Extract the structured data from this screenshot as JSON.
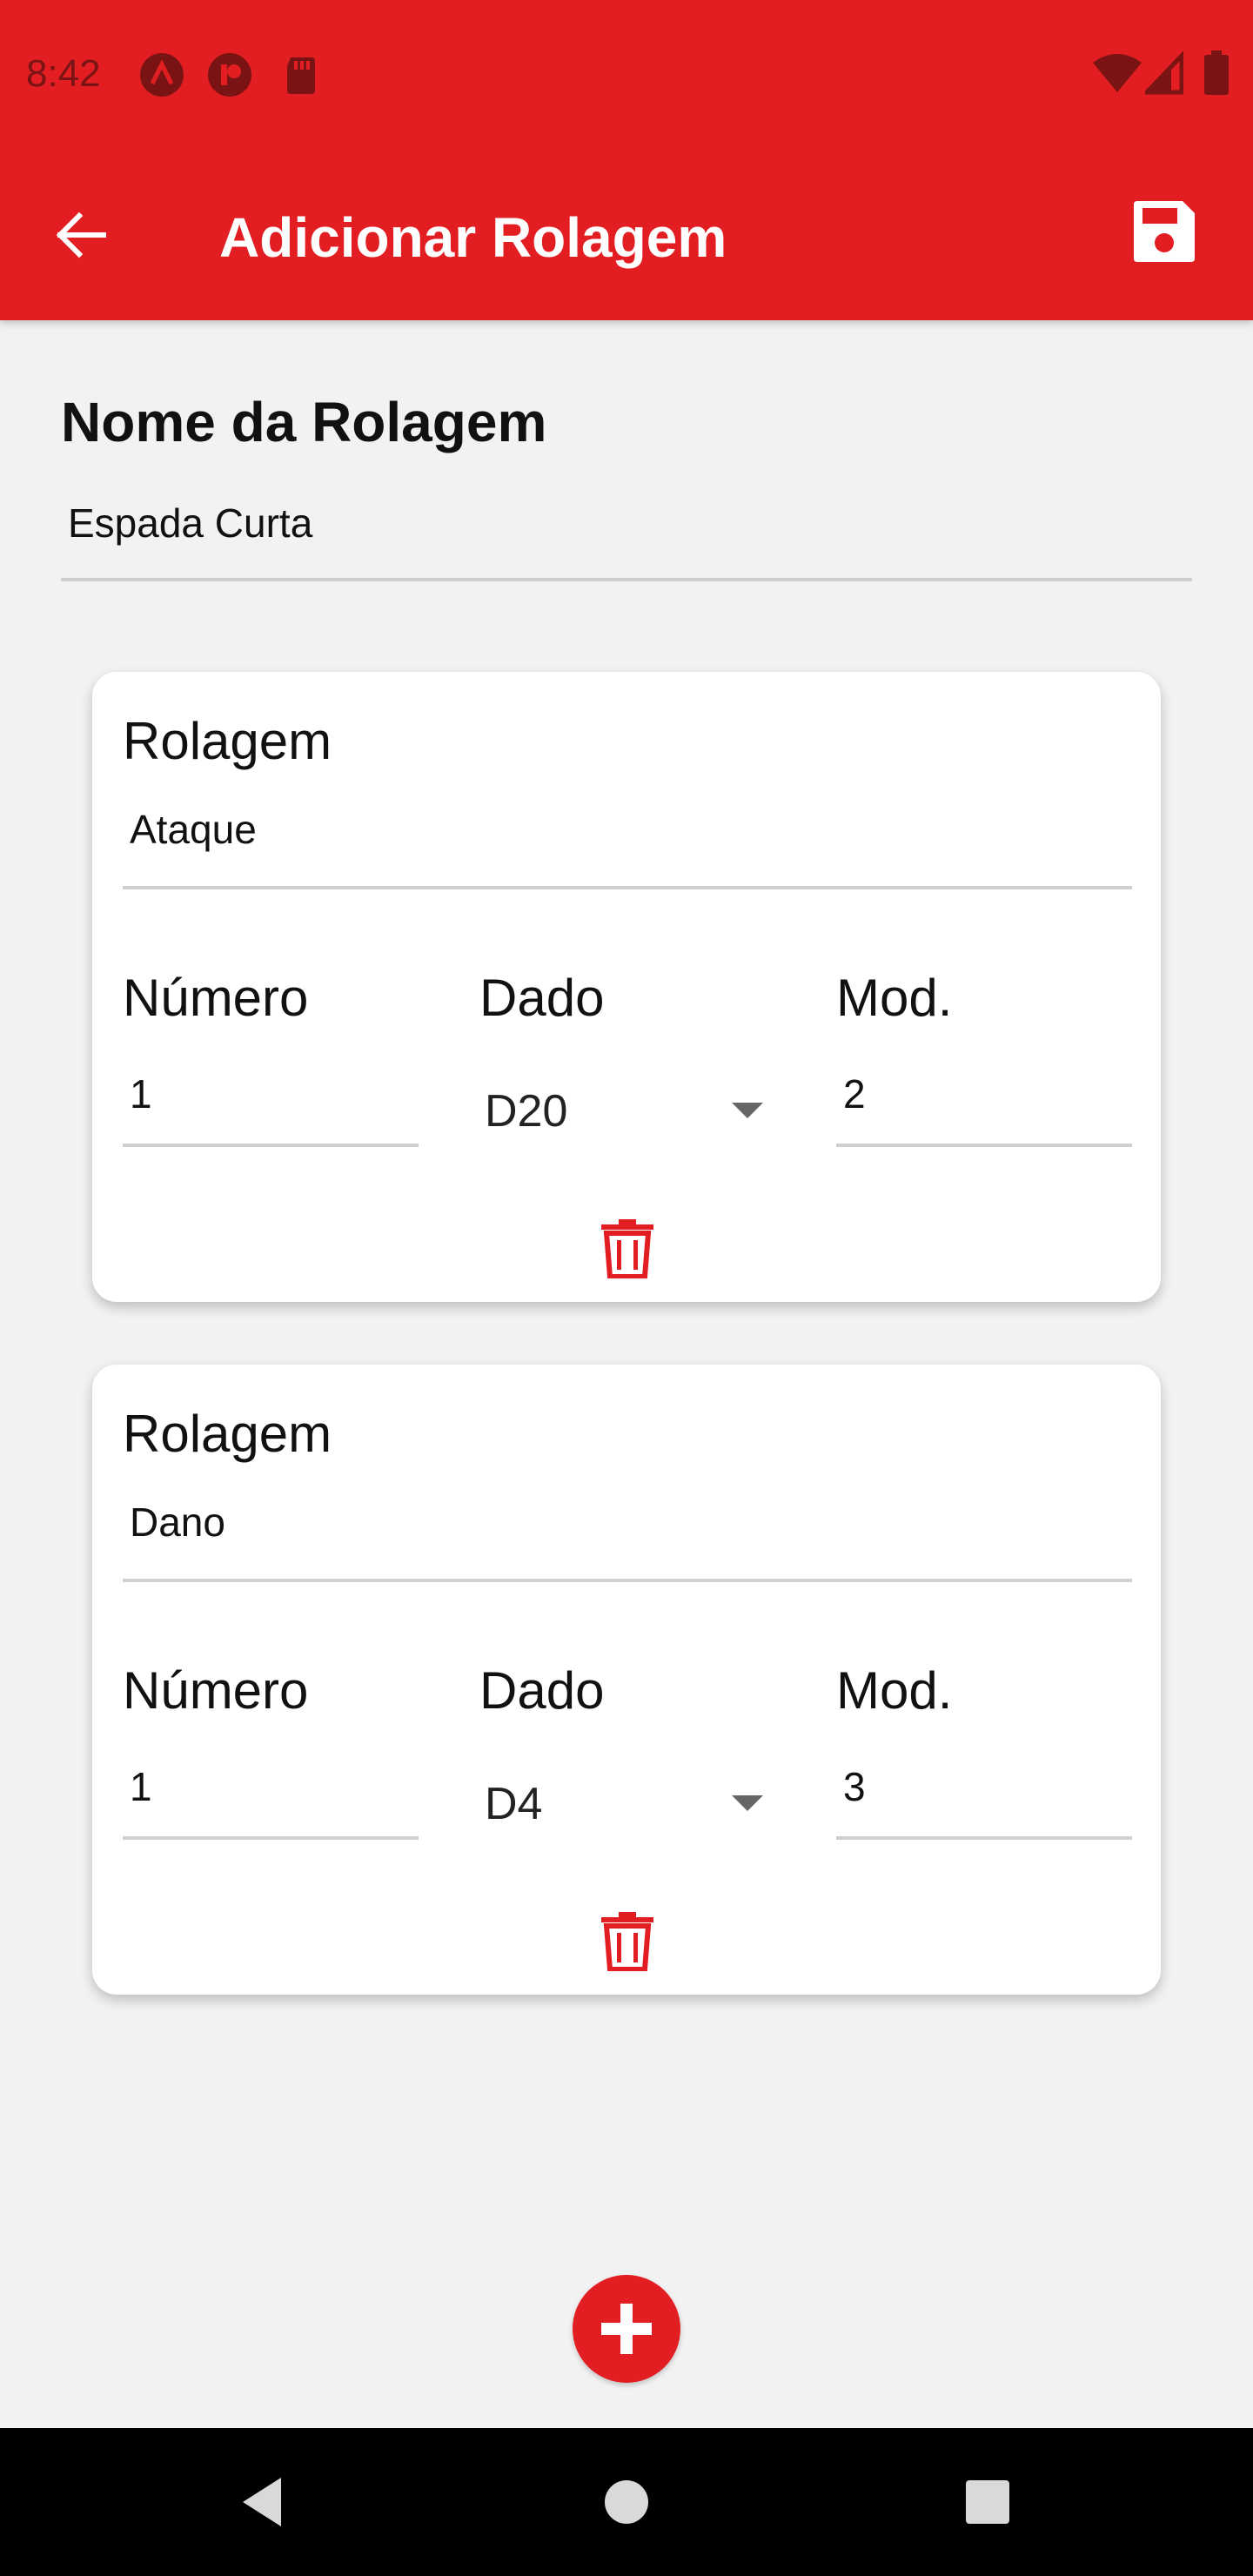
{
  "status_bar": {
    "time": "8:42",
    "left_icons": [
      "app-a-icon",
      "app-p-icon",
      "sd-card-icon"
    ],
    "right_icons": [
      "wifi-icon",
      "signal-icon",
      "battery-icon"
    ]
  },
  "app_bar": {
    "title": "Adicionar Rolagem",
    "back_icon": "arrow-back-icon",
    "save_icon": "save-icon"
  },
  "name_section": {
    "label": "Nome da Rolagem",
    "value": "Espada Curta"
  },
  "rolls": [
    {
      "title": "Rolagem",
      "name": "Ataque",
      "numero_label": "Número",
      "numero": "1",
      "dado_label": "Dado",
      "dado": "D20",
      "mod_label": "Mod.",
      "mod": "2"
    },
    {
      "title": "Rolagem",
      "name": "Dano",
      "numero_label": "Número",
      "numero": "1",
      "dado_label": "Dado",
      "dado": "D4",
      "mod_label": "Mod.",
      "mod": "3"
    }
  ],
  "fab_icon": "add-icon",
  "nav_bar": [
    "back-triangle-icon",
    "home-circle-icon",
    "recents-square-icon"
  ],
  "colors": {
    "primary": "#e31e22",
    "background": "#f2f2f2"
  }
}
